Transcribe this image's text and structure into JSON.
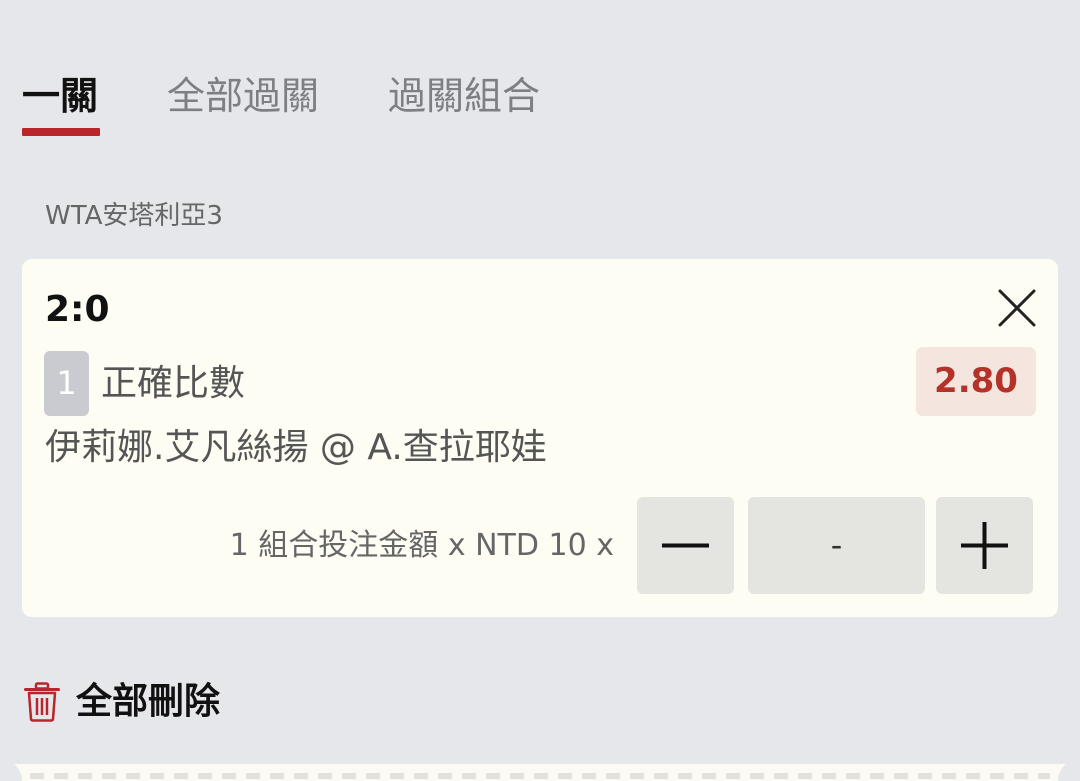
{
  "tabs": [
    {
      "label": "一關",
      "active": true
    },
    {
      "label": "全部過關",
      "active": false
    },
    {
      "label": "過關組合",
      "active": false
    }
  ],
  "league": "WTA安塔利亞3",
  "bet": {
    "selection": "2:0",
    "leg_number": "1",
    "market": "正確比數",
    "odds": "2.80",
    "event": "伊莉娜.艾凡絲揚 @ A.查拉耶娃",
    "stake_text": "1 組合投注金額 x NTD 10 x",
    "stake_value": "-"
  },
  "actions": {
    "delete_all_label": "全部刪除"
  },
  "colors": {
    "accent": "#b8262a",
    "odds_text": "#b4322a",
    "odds_bg": "#f4e5df",
    "card_bg": "#fdfdf4",
    "page_bg": "#e6e7ea"
  },
  "icons": {
    "close": "close-icon",
    "minus": "minus-icon",
    "plus": "plus-icon",
    "trash": "trash-icon"
  }
}
